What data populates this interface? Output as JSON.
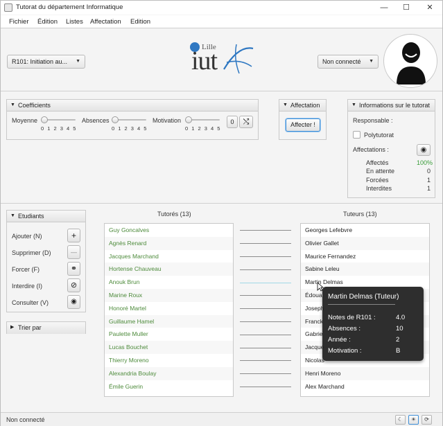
{
  "window": {
    "title": "Tutorat du département Informatique",
    "minimize": "—",
    "maximize": "☐",
    "close": "✕"
  },
  "menu": [
    "Fichier",
    "Édition",
    "Listes",
    "Affectation",
    "Edition"
  ],
  "header": {
    "resource_select": "R101: Initiation au...",
    "logo_city": "Lille",
    "logo_text": "iut",
    "connection_select": "Non connecté"
  },
  "coefficients": {
    "title": "Coefficients",
    "sliders": [
      {
        "label": "Moyenne",
        "ticks": "0 1 2 3 4 5",
        "value": 0
      },
      {
        "label": "Absences",
        "ticks": "0 1 2 3 4 5",
        "value": 0
      },
      {
        "label": "Motivation",
        "ticks": "0 1 2 3 4 5",
        "value": 0
      }
    ],
    "reset_label": "0",
    "shuffle_icon": "⤭"
  },
  "affectation": {
    "title": "Affectation",
    "button": "Affecter !"
  },
  "info": {
    "title": "Informations sur le tutorat",
    "responsable": "Responsable :",
    "polytutorat": "Polytutorat",
    "affectations": "Affectations :",
    "stats": [
      {
        "label": "Affectés",
        "value": "100%"
      },
      {
        "label": "En attente",
        "value": "0"
      },
      {
        "label": "Forcées",
        "value": "1"
      },
      {
        "label": "Interdites",
        "value": "1"
      }
    ]
  },
  "etudiants": {
    "title": "Etudiants",
    "actions": [
      {
        "label": "Ajouter (N)",
        "icon": "+"
      },
      {
        "label": "Supprimer (D)",
        "icon": "—"
      },
      {
        "label": "Forcer (F)",
        "icon": "⚭"
      },
      {
        "label": "Interdire (I)",
        "icon": "⊘"
      },
      {
        "label": "Consulter (V)",
        "icon": "◉"
      }
    ]
  },
  "trier": {
    "title": "Trier par"
  },
  "tutores": {
    "header": "Tutorés (13)",
    "items": [
      "Guy Goncalves",
      "Agnès Renard",
      "Jacques Marchand",
      "Hortense Chauveau",
      "Anouk Brun",
      "Marine Roux",
      "Honoré Martel",
      "Guillaume Hamel",
      "Paulette Muller",
      "Lucas Bouchet",
      "Thierry Moreno",
      "Alexandria Boulay",
      "Émile Guerin"
    ]
  },
  "tuteurs": {
    "header": "Tuteurs (13)",
    "items": [
      "Georges Lefebvre",
      "Olivier Gallet",
      "Maurice Fernandez",
      "Sabine Leleu",
      "Martin Delmas",
      "Édoua",
      "Joseph",
      "Franck",
      "Gabrie",
      "Jacque",
      "Nicolas",
      "Henri Moreno",
      "Alex Marchand"
    ]
  },
  "tooltip": {
    "title": "Martin Delmas (Tuteur)",
    "rule": "————————————————",
    "rows": [
      {
        "label": "Notes de R101 :",
        "value": "4.0"
      },
      {
        "label": "Absences :",
        "value": "10"
      },
      {
        "label": "Année :",
        "value": "2"
      },
      {
        "label": "Motivation :",
        "value": "B"
      }
    ]
  },
  "status": {
    "text": "Non connecté",
    "btn1": "☾",
    "btn2": "☀",
    "btn3": "⟳"
  }
}
